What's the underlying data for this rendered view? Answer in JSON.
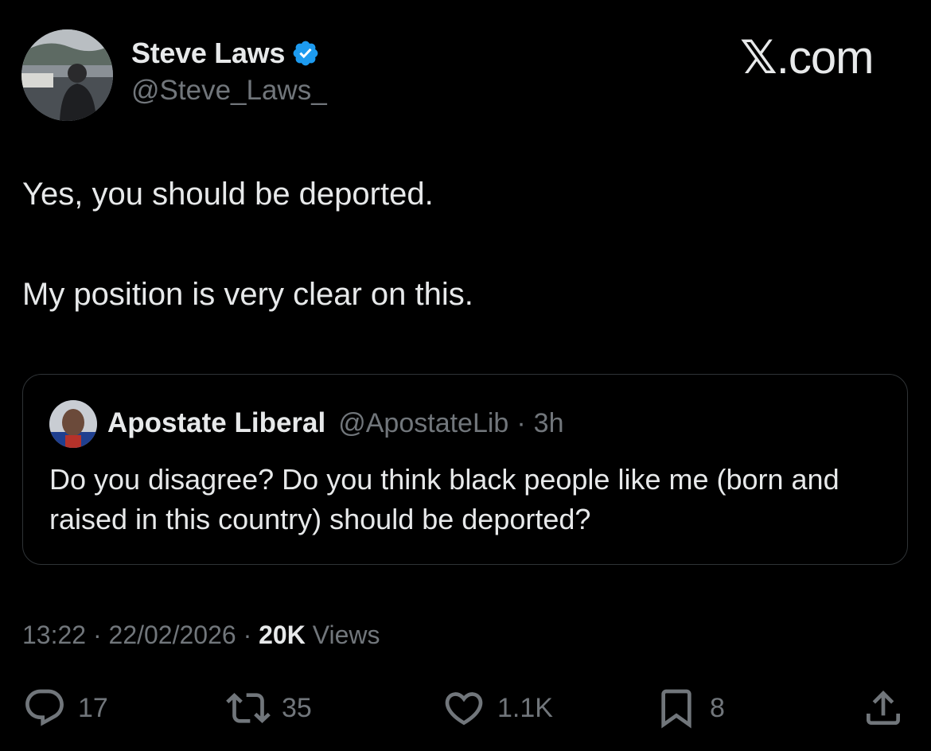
{
  "author": {
    "name": "Steve Laws",
    "handle": "@Steve_Laws_",
    "verified_color": "#1d9bf0"
  },
  "brand": {
    "x": "𝕏",
    "suffix": ".com"
  },
  "tweet": {
    "line1": "Yes, you should be deported.",
    "line2": "My position is very clear on this."
  },
  "quoted": {
    "name": "Apostate Liberal",
    "handle": "@ApostateLib",
    "separator": "·",
    "age": "3h",
    "text": "Do you disagree? Do you think black people like me (born and raised in this country) should be deported?"
  },
  "meta": {
    "time": "13:22",
    "sep1": "·",
    "date": "22/02/2026",
    "sep2": "·",
    "views_count": "20K",
    "views_label": "Views"
  },
  "actions": {
    "replies": "17",
    "reposts": "35",
    "likes": "1.1K",
    "bookmarks": "8"
  },
  "icons": [
    "verified-badge-icon",
    "reply-icon",
    "repost-icon",
    "like-icon",
    "bookmark-icon",
    "share-icon"
  ],
  "colors": {
    "background": "#000000",
    "text": "#e7e9ea",
    "secondary": "#71767b",
    "border": "#2f3336",
    "accent": "#1d9bf0"
  }
}
